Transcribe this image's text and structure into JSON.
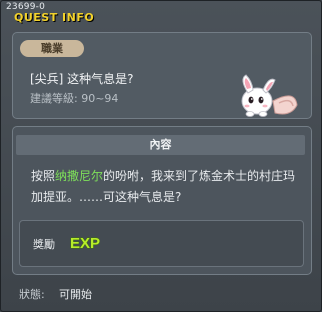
{
  "titlebar": {
    "quest_id": "23699-0",
    "title": "QUEST INFO"
  },
  "job_panel": {
    "badge": "職業",
    "quest_name": "[尖兵] 这种气息是?",
    "required_level": "建議等級: 90~94"
  },
  "content": {
    "header": "內容",
    "text_before": "按照",
    "npc_name": "纳撒尼尔",
    "text_after": "的吩咐，我来到了炼金术士的村庄玛加提亚。……可这种气息是?"
  },
  "reward": {
    "label": "獎勵",
    "exp": "EXP"
  },
  "status": {
    "label": "狀態:",
    "value": "可開始"
  },
  "colors": {
    "title": "#f2d22c",
    "npc_name": "#7ee05a",
    "exp": "#b8ec2a"
  },
  "icons": [
    "npc-creature-icon",
    "exp-icon"
  ]
}
